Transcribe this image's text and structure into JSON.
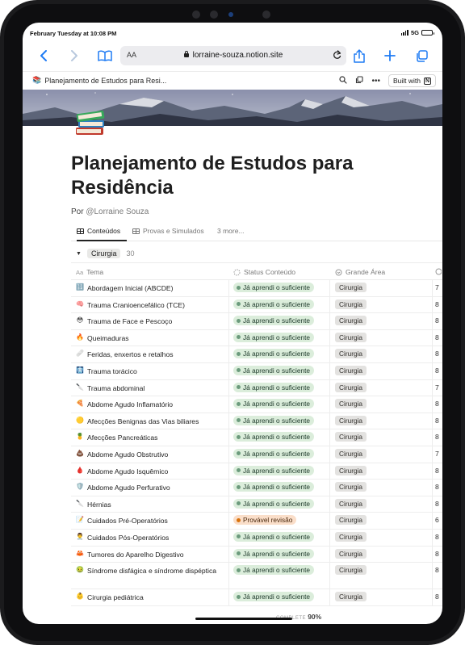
{
  "status_bar": {
    "time": "February Tuesday at 10:08 PM",
    "network": "5G"
  },
  "browser": {
    "reader_label": "AA",
    "url": "lorraine-souza.notion.site"
  },
  "notion_bar": {
    "breadcrumb": "Planejamento de Estudos para Resi...",
    "built_with": "Built with",
    "notion_logo": "N"
  },
  "page": {
    "title": "Planejamento de Estudos para Residência",
    "by_prefix": "Por",
    "author": "@Lorraine Souza"
  },
  "tabs": [
    {
      "label": "Conteúdos"
    },
    {
      "label": "Provas e Simulados"
    },
    {
      "label": "3 more..."
    }
  ],
  "group": {
    "label": "Cirurgia",
    "count": "30"
  },
  "columns": {
    "tema": "Tema",
    "tema_prefix": "Aa",
    "status": "Status Conteúdo",
    "area": "Grande Área"
  },
  "rows": [
    {
      "emoji": "🔢",
      "tema": "Abordagem Inicial (ABCDE)",
      "status": "Já aprendi o suficiente",
      "area": "Cirurgia",
      "extra": "7"
    },
    {
      "emoji": "🧠",
      "tema": "Trauma Cranioencefálico (TCE)",
      "status": "Já aprendi o suficiente",
      "area": "Cirurgia",
      "extra": "8"
    },
    {
      "emoji": "😳",
      "tema": "Trauma de Face e Pescoço",
      "status": "Já aprendi o suficiente",
      "area": "Cirurgia",
      "extra": "8"
    },
    {
      "emoji": "🔥",
      "tema": "Queimaduras",
      "status": "Já aprendi o suficiente",
      "area": "Cirurgia",
      "extra": "8"
    },
    {
      "emoji": "🩹",
      "tema": "Feridas, enxertos e retalhos",
      "status": "Já aprendi o suficiente",
      "area": "Cirurgia",
      "extra": "8"
    },
    {
      "emoji": "🩻",
      "tema": "Trauma torácico",
      "status": "Já aprendi o suficiente",
      "area": "Cirurgia",
      "extra": "8"
    },
    {
      "emoji": "🔪",
      "tema": "Trauma abdominal",
      "status": "Já aprendi o suficiente",
      "area": "Cirurgia",
      "extra": "7"
    },
    {
      "emoji": "🍕",
      "tema": "Abdome Agudo Inflamatório",
      "status": "Já aprendi o suficiente",
      "area": "Cirurgia",
      "extra": "8"
    },
    {
      "emoji": "🟡",
      "tema": "Afecções Benignas das Vias biliares",
      "status": "Já aprendi o suficiente",
      "area": "Cirurgia",
      "extra": "8"
    },
    {
      "emoji": "🍍",
      "tema": "Afecções Pancreáticas",
      "status": "Já aprendi o suficiente",
      "area": "Cirurgia",
      "extra": "8"
    },
    {
      "emoji": "💩",
      "tema": "Abdome Agudo Obstrutivo",
      "status": "Já aprendi o suficiente",
      "area": "Cirurgia",
      "extra": "7"
    },
    {
      "emoji": "🩸",
      "tema": "Abdome Agudo Isquêmico",
      "status": "Já aprendi o suficiente",
      "area": "Cirurgia",
      "extra": "8"
    },
    {
      "emoji": "🛡️",
      "tema": "Abdome Agudo Perfurativo",
      "status": "Já aprendi o suficiente",
      "area": "Cirurgia",
      "extra": "8"
    },
    {
      "emoji": "🔪",
      "tema": "Hérnias",
      "status": "Já aprendi o suficiente",
      "area": "Cirurgia",
      "extra": "8"
    },
    {
      "emoji": "📝",
      "tema": "Cuidados Pré-Operatórios",
      "status": "Provável revisão",
      "area": "Cirurgia",
      "extra": "6",
      "review": true
    },
    {
      "emoji": "👨‍⚕️",
      "tema": "Cuidados Pós-Operatórios",
      "status": "Já aprendi o suficiente",
      "area": "Cirurgia",
      "extra": "8"
    },
    {
      "emoji": "🦀",
      "tema": "Tumores do Aparelho Digestivo",
      "status": "Já aprendi o suficiente",
      "area": "Cirurgia",
      "extra": "8"
    },
    {
      "emoji": "🤢",
      "tema": "Síndrome disfágica e síndrome dispéptica",
      "status": "Já aprendi o suficiente",
      "area": "Cirurgia",
      "extra": "8",
      "tall": true
    },
    {
      "emoji": "👶",
      "tema": "Cirurgia pediátrica",
      "status": "Já aprendi o suficiente",
      "area": "Cirurgia",
      "extra": "8"
    }
  ],
  "footer": {
    "complete_label": "COMPLETE",
    "complete_value": "90%"
  },
  "colors": {
    "safari_blue": "#1e7bf4",
    "status_green_bg": "#dbeddb",
    "status_orange_bg": "#fadec9",
    "area_gray_bg": "#e3e2e0"
  }
}
